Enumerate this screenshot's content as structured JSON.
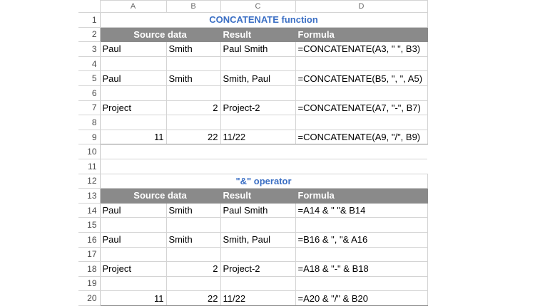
{
  "columns": [
    "A",
    "B",
    "C",
    "D"
  ],
  "section1": {
    "title": "CONCATENATE function",
    "headers": {
      "source": "Source data",
      "result": "Result",
      "formula": "Formula"
    }
  },
  "section2": {
    "title": "\"&\" operator",
    "headers": {
      "source": "Source data",
      "result": "Result",
      "formula": "Formula"
    }
  },
  "rows": {
    "r1": "1",
    "r2": "2",
    "r3": "3",
    "r4": "4",
    "r5": "5",
    "r6": "6",
    "r7": "7",
    "r8": "8",
    "r9": "9",
    "r10": "10",
    "r11": "11",
    "r12": "12",
    "r13": "13",
    "r14": "14",
    "r15": "15",
    "r16": "16",
    "r17": "17",
    "r18": "18",
    "r19": "19",
    "r20": "20"
  },
  "cells": {
    "A3": "Paul",
    "B3": "Smith",
    "C3": "Paul  Smith",
    "D3": "=CONCATENATE(A3, \"  \", B3)",
    "A5": "Paul",
    "B5": "Smith",
    "C5": "Smith, Paul",
    "D5": "=CONCATENATE(B5, \", \", A5)",
    "A7": "Project",
    "B7": "2",
    "C7": "Project-2",
    "D7": "=CONCATENATE(A7, \"-\", B7)",
    "A9": "11",
    "B9": "22",
    "C9": "11/22",
    "D9": "=CONCATENATE(A9, \"/\", B9)",
    "A14": "Paul",
    "B14": "Smith",
    "C14": "Paul Smith",
    "D14": "=A14 & \" \"& B14",
    "A16": "Paul",
    "B16": "Smith",
    "C16": "Smith, Paul",
    "D16": "=B16 & \", \"& A16",
    "A18": "Project",
    "B18": "2",
    "C18": "Project-2",
    "D18": "=A18 & \"-\" & B18",
    "A20": "11",
    "B20": "22",
    "C20": "11/22",
    "D20": "=A20 & \"/\" & B20"
  }
}
